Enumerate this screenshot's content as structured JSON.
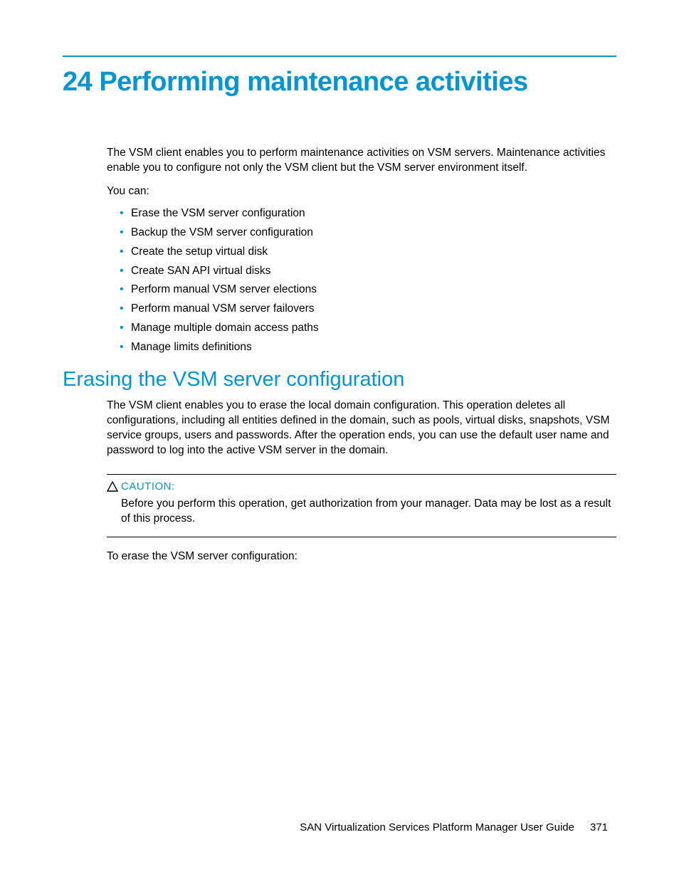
{
  "chapter": {
    "title": "24 Performing maintenance activities"
  },
  "intro": {
    "p1": "The VSM client enables you to perform maintenance activities on VSM servers. Maintenance activities enable you to configure not only the VSM client but the VSM server environment itself.",
    "lead": "You can:",
    "bullets": [
      "Erase the VSM server configuration",
      "Backup the VSM server configuration",
      "Create the setup virtual disk",
      "Create SAN API virtual disks",
      "Perform manual VSM server elections",
      "Perform manual VSM server failovers",
      "Manage multiple domain access paths",
      "Manage limits definitions"
    ]
  },
  "section": {
    "title": "Erasing the VSM server configuration",
    "p1": "The VSM client enables you to erase the local domain configuration. This operation deletes all configurations, including all entities defined in the domain, such as pools, virtual disks, snapshots, VSM service groups, users and passwords. After the operation ends, you can use the default user name and password to log into the active VSM server in the domain."
  },
  "caution": {
    "label": "CAUTION:",
    "text": "Before you perform this operation, get authorization from your manager. Data may be lost as a result of this process."
  },
  "after_caution": "To erase the VSM server configuration:",
  "footer": {
    "doc_title": "SAN Virtualization Services Platform Manager User Guide",
    "page_number": "371"
  }
}
